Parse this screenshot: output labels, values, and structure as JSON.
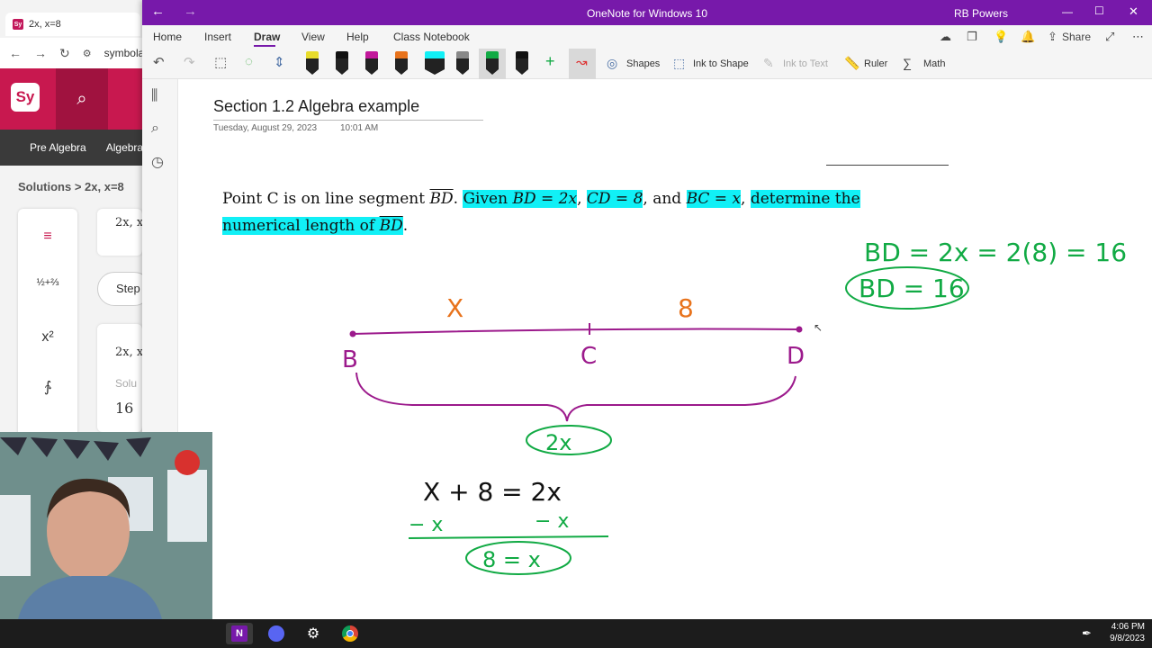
{
  "background_browser": {
    "tab_title": "2x, x=8",
    "favicon": "Sy",
    "url": "symbola",
    "logo": "Sy",
    "nav": [
      "Pre Algebra",
      "Algebra"
    ],
    "breadcrumb": "Solutions > 2x, x=8",
    "card_1": "2x, x",
    "step_button": "Step",
    "card_2": "2x, x",
    "solution_label": "Solu",
    "result": "16",
    "side_items": [
      "≡",
      "½+⅔",
      "x²",
      "∱"
    ]
  },
  "onenote": {
    "window_title": "OneNote for Windows 10",
    "user": "RB Powers",
    "ribbon_tabs": [
      "Home",
      "Insert",
      "Draw",
      "View",
      "Help",
      "Class Notebook"
    ],
    "active_tab": "Draw",
    "share_label": "Share",
    "tools": {
      "shapes": "Shapes",
      "ink_to_shape": "Ink to Shape",
      "ink_to_text": "Ink to Text",
      "ruler": "Ruler",
      "math": "Math"
    },
    "pen_colors": [
      "#e8dc2c",
      "#111111",
      "#c2189b",
      "#e8731c",
      "#11f0f6",
      "#888888",
      "#11aa44",
      "#111111"
    ],
    "page": {
      "title": "Section 1.2 Algebra example",
      "date": "Tuesday, August 29, 2023",
      "time": "10:01 AM",
      "problem": {
        "p1": "Point C is on line segment ",
        "seg": "BD",
        "p2": ". ",
        "h1": "Given ",
        "m1": "BD = 2x",
        "p3": ", ",
        "m2": "CD = 8",
        "p4": ", and ",
        "m3": "BC = x",
        "p5": ", ",
        "h2": "determine the",
        "h3": "numerical length of ",
        "seg2": "BD",
        "p6": "."
      }
    },
    "ink": {
      "label_x": "X",
      "label_8": "8",
      "point_b": "B",
      "point_c": "C",
      "point_d": "D",
      "brace_label": "2x",
      "equation_1": "X + 8 = 2x",
      "minus_left": "− x",
      "minus_right": "− x",
      "result": "8 = x",
      "side_work_1": "BD = 2x = 2(8) = 16",
      "side_result": "BD = 16"
    }
  },
  "taskbar": {
    "apps": [
      "onenote",
      "discord",
      "settings",
      "chrome"
    ],
    "time": "4:06 PM",
    "date": "9/8/2023"
  }
}
